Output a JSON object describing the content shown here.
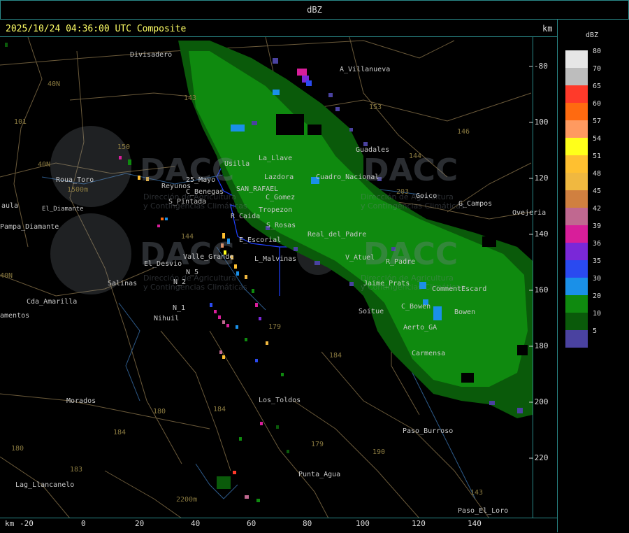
{
  "header": {
    "units_label": "dBZ"
  },
  "map": {
    "title": "2025/10/24 04:36:00 UTC Composite",
    "km_label_top": "km",
    "km_label_bottom": "km",
    "y_ticks": [
      "-80",
      "-100",
      "-120",
      "-140",
      "-160",
      "-180",
      "-200",
      "-220"
    ],
    "x_ticks": [
      "-20",
      "0",
      "20",
      "40",
      "60",
      "80",
      "100",
      "120",
      "140"
    ],
    "places": [
      {
        "name": "Divisadero"
      },
      {
        "name": "A_Villanueva"
      },
      {
        "name": "Guadales"
      },
      {
        "name": "Usilla"
      },
      {
        "name": "La_Llave"
      },
      {
        "name": "Cuadro_Nacional"
      },
      {
        "name": "Roua_Toro"
      },
      {
        "name": "Reyunos"
      },
      {
        "name": "25_Mayo"
      },
      {
        "name": "C_Benegas"
      },
      {
        "name": "SAN_RAFAEL"
      },
      {
        "name": "Lazdora"
      },
      {
        "name": "Goico"
      },
      {
        "name": "G_Campos"
      },
      {
        "name": "Ovejeria"
      },
      {
        "name": "aula"
      },
      {
        "name": "S_Pintada"
      },
      {
        "name": "C_Gomez"
      },
      {
        "name": "Pampa_Diamante"
      },
      {
        "name": "El_Diamante"
      },
      {
        "name": "Tropezon"
      },
      {
        "name": "R_Caida"
      },
      {
        "name": "S_Rosas"
      },
      {
        "name": "Real_del_Padre"
      },
      {
        "name": "E_Escorial"
      },
      {
        "name": "Valle_Grande"
      },
      {
        "name": "L_Malvinas"
      },
      {
        "name": "V_Atuel"
      },
      {
        "name": "El_Desvio"
      },
      {
        "name": "R_Padre"
      },
      {
        "name": "N_5"
      },
      {
        "name": "N_2"
      },
      {
        "name": "Salinas"
      },
      {
        "name": "Jaime_Prats"
      },
      {
        "name": "Cda_Amarilla"
      },
      {
        "name": "N_1"
      },
      {
        "name": "C_Bowen"
      },
      {
        "name": "Bowen"
      },
      {
        "name": "CommentEscard"
      },
      {
        "name": "Soitue"
      },
      {
        "name": "amentos"
      },
      {
        "name": "Nihuil"
      },
      {
        "name": "Aerto_GA"
      },
      {
        "name": "Carmensa"
      },
      {
        "name": "Morados"
      },
      {
        "name": "Los_Toldos"
      },
      {
        "name": "Paso_Burroso"
      },
      {
        "name": "Lag_Llancanelo"
      },
      {
        "name": "Punta_Agua"
      },
      {
        "name": "Paso_El_Loro"
      }
    ],
    "routes": [
      "143",
      "153",
      "146",
      "144",
      "40N",
      "101",
      "150",
      "40N",
      "203",
      "144",
      "40N",
      "179",
      "184",
      "180",
      "184",
      "184",
      "183",
      "179",
      "190",
      "143",
      "180"
    ],
    "elevations": [
      "1500m",
      "2200m"
    ],
    "watermark": {
      "brand": "DACC",
      "subtitle_line1": "Dirección de Agricultura",
      "subtitle_line2": "y Contingencias Climáticas"
    }
  },
  "legend": {
    "title": "dBZ",
    "levels": [
      {
        "value": "80",
        "color": "#e6e6e6"
      },
      {
        "value": "70",
        "color": "#bdbdbd"
      },
      {
        "value": "65",
        "color": "#ff3a2a"
      },
      {
        "value": "60",
        "color": "#ff6a10"
      },
      {
        "value": "57",
        "color": "#ff9a60"
      },
      {
        "value": "54",
        "color": "#ffff1a"
      },
      {
        "value": "51",
        "color": "#ffc030"
      },
      {
        "value": "48",
        "color": "#f0b840"
      },
      {
        "value": "45",
        "color": "#d08040"
      },
      {
        "value": "42",
        "color": "#c06890"
      },
      {
        "value": "39",
        "color": "#d81e9a"
      },
      {
        "value": "36",
        "color": "#7a28d8"
      },
      {
        "value": "35",
        "color": "#2a4af0"
      },
      {
        "value": "30",
        "color": "#1a90e8"
      },
      {
        "value": "20",
        "color": "#0f8a0f"
      },
      {
        "value": "10",
        "color": "#0a5a0a"
      },
      {
        "value": "5",
        "color": "#4a42a0"
      }
    ]
  }
}
